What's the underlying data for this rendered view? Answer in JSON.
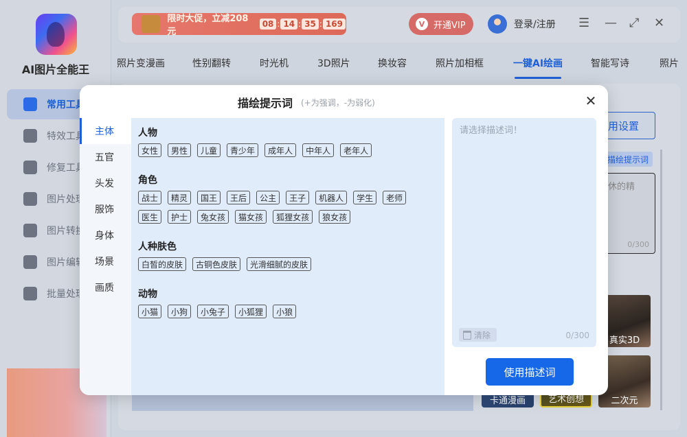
{
  "app": {
    "name": "AI图片全能王",
    "sidebar": [
      {
        "label": "常用工具",
        "icon": "grid-icon",
        "active": true
      },
      {
        "label": "特效工具",
        "icon": "star-icon"
      },
      {
        "label": "修复工具",
        "icon": "bandage-icon"
      },
      {
        "label": "图片处理",
        "icon": "image-icon"
      },
      {
        "label": "图片转换",
        "icon": "convert-icon"
      },
      {
        "label": "图片编辑",
        "icon": "edit-icon"
      },
      {
        "label": "批量处理",
        "icon": "upload-icon"
      }
    ]
  },
  "topbar": {
    "promo_text": "限时大促，立减208元",
    "countdown": [
      "08",
      "14",
      "35",
      "169"
    ],
    "vip_label": "开通VIP",
    "login_label": "登录/注册"
  },
  "nav_tabs": [
    {
      "label": "照片变漫画"
    },
    {
      "label": "性别翻转"
    },
    {
      "label": "时光机"
    },
    {
      "label": "3D照片"
    },
    {
      "label": "换妆容"
    },
    {
      "label": "照片加相框"
    },
    {
      "label": "一键AI绘画",
      "active": true
    },
    {
      "label": "智能写诗"
    },
    {
      "label": "照片"
    }
  ],
  "background_panel": {
    "settings_btn": "用设置",
    "prompt_tag": "描绘提示词",
    "prompt_text": "休的精",
    "prompt_count": "0/300",
    "styles": [
      "真实3D",
      "卡通漫画",
      "艺术创想",
      "二次元"
    ]
  },
  "modal": {
    "title": "描绘提示词",
    "subtitle": "(+为强调，-为弱化)",
    "categories": [
      {
        "label": "主体",
        "active": true
      },
      {
        "label": "五官"
      },
      {
        "label": "头发"
      },
      {
        "label": "服饰"
      },
      {
        "label": "身体"
      },
      {
        "label": "场景"
      },
      {
        "label": "画质"
      }
    ],
    "groups": [
      {
        "title": "人物",
        "rows": [
          [
            "女性",
            "男性",
            "儿童",
            "青少年",
            "成年人",
            "中年人",
            "老年人"
          ]
        ]
      },
      {
        "title": "角色",
        "rows": [
          [
            "战士",
            "精灵",
            "国王",
            "王后",
            "公主",
            "王子",
            "机器人",
            "学生",
            "老师"
          ],
          [
            "医生",
            "护士",
            "兔女孩",
            "猫女孩",
            "狐狸女孩",
            "狼女孩"
          ]
        ]
      },
      {
        "title": "人种肤色",
        "rows": [
          [
            "白皙的皮肤",
            "古铜色皮肤",
            "光滑细腻的皮肤"
          ]
        ]
      },
      {
        "title": "动物",
        "rows": [
          [
            "小猫",
            "小狗",
            "小兔子",
            "小狐狸",
            "小狼"
          ]
        ]
      }
    ],
    "selected_placeholder": "请选择描述词！",
    "clear_label": "清除",
    "selected_count": "0/300",
    "use_button": "使用描述词"
  }
}
